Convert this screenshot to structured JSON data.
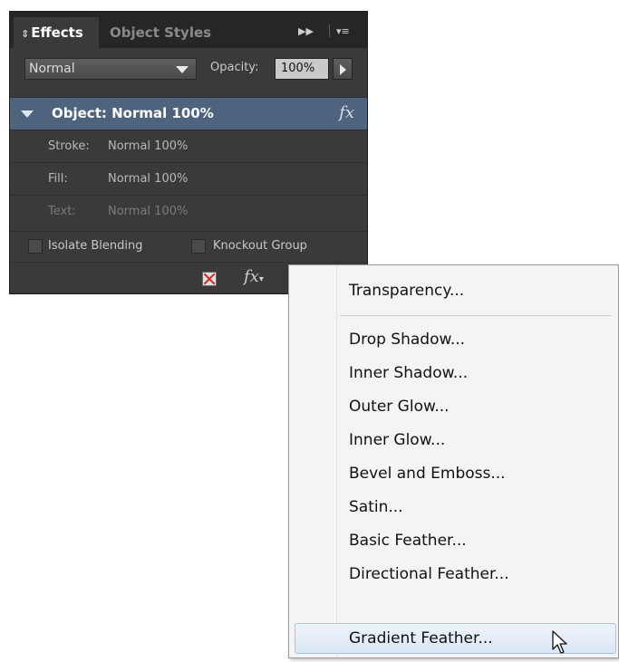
{
  "panel": {
    "tabs": [
      {
        "label": "Effects",
        "icon": "updown-arrows-icon"
      },
      {
        "label": "Object Styles"
      }
    ],
    "blend_mode": "Normal",
    "opacity_label": "Opacity:",
    "opacity_value": "100%",
    "object_row": {
      "label": "Object:",
      "value": "Normal 100%"
    },
    "rows": [
      {
        "label": "Stroke:",
        "value": "Normal 100%"
      },
      {
        "label": "Fill:",
        "value": "Normal 100%"
      },
      {
        "label": "Text:",
        "value": "Normal 100%"
      }
    ],
    "isolate_blending": "Isolate Blending",
    "knockout_group": "Knockout Group",
    "fx_symbol": "fx"
  },
  "menu": {
    "items": [
      "Transparency...",
      "Drop Shadow...",
      "Inner Shadow...",
      "Outer Glow...",
      "Inner Glow...",
      "Bevel and Emboss...",
      "Satin...",
      "Basic Feather...",
      "Directional Feather...",
      "Gradient Feather..."
    ],
    "highlighted": "Gradient Feather..."
  }
}
